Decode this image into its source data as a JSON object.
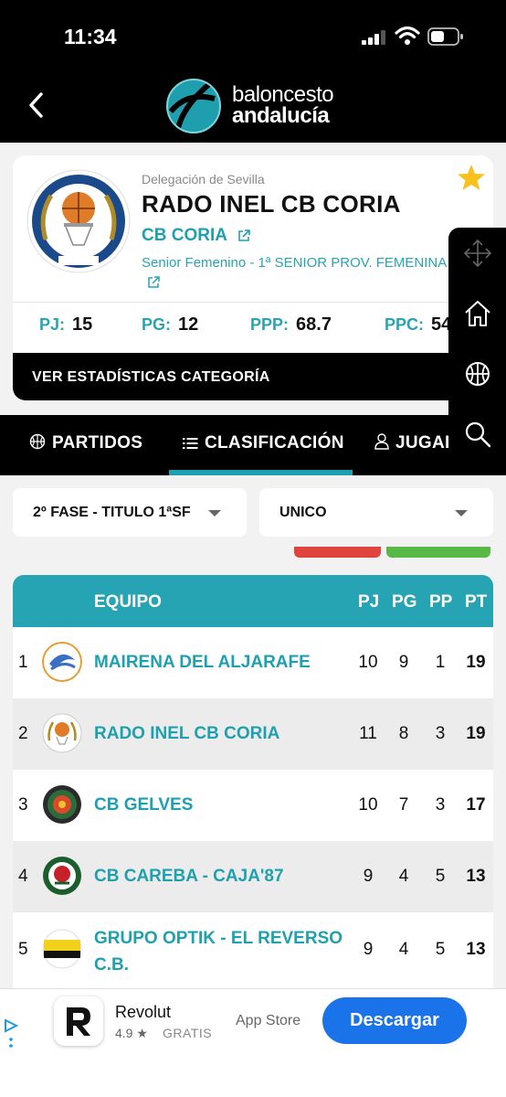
{
  "status_bar": {
    "time": "11:34"
  },
  "header": {
    "logo_line1": "baloncesto",
    "logo_line2": "andalucía"
  },
  "team_card": {
    "delegation": "Delegación de Sevilla",
    "team_name": "RADO INEL CB CORIA",
    "club": "CB CORIA",
    "category": "Senior Femenino - 1ª SENIOR PROV. FEMENINA 25/26",
    "stats": [
      {
        "key": "PJ:",
        "value": "15"
      },
      {
        "key": "PG:",
        "value": "12"
      },
      {
        "key": "PPP:",
        "value": "68.7"
      },
      {
        "key": "PPC:",
        "value": "54"
      }
    ],
    "stats_button": "VER ESTADÍSTICAS CATEGORÍA"
  },
  "tabs": [
    {
      "label": "PARTIDOS",
      "icon": "basketball-icon",
      "active": false
    },
    {
      "label": "CLASIFICACIÓN",
      "icon": "list-icon",
      "active": true
    },
    {
      "label": "JUGADORAS",
      "icon": "user-icon",
      "active": false
    }
  ],
  "filters": {
    "phase": "2º FASE - TITULO 1ªSF",
    "group": "UNICO"
  },
  "table": {
    "headers": {
      "team": "EQUIPO",
      "pj": "PJ",
      "pg": "PG",
      "pp": "PP",
      "pt": "PT"
    },
    "rows": [
      {
        "pos": "1",
        "team": "MAIRENA DEL ALJARAFE",
        "pj": "10",
        "pg": "9",
        "pp": "1",
        "pt": "19"
      },
      {
        "pos": "2",
        "team": "RADO INEL CB CORIA",
        "pj": "11",
        "pg": "8",
        "pp": "3",
        "pt": "19"
      },
      {
        "pos": "3",
        "team": "CB GELVES",
        "pj": "10",
        "pg": "7",
        "pp": "3",
        "pt": "17"
      },
      {
        "pos": "4",
        "team": "CB CAREBA - CAJA'87",
        "pj": "9",
        "pg": "4",
        "pp": "5",
        "pt": "13"
      },
      {
        "pos": "5",
        "team": "GRUPO OPTIK - EL REVERSO C.B.",
        "pj": "9",
        "pg": "4",
        "pp": "5",
        "pt": "13"
      }
    ]
  },
  "ad": {
    "app_name": "Revolut",
    "rating": "4.9 ★",
    "price": "GRATIS",
    "store": "App Store",
    "cta": "Descargar"
  },
  "colors": {
    "accent": "#27a4b4",
    "header_bg": "#000000",
    "star": "#f7c21b",
    "cta": "#1a73e8"
  }
}
